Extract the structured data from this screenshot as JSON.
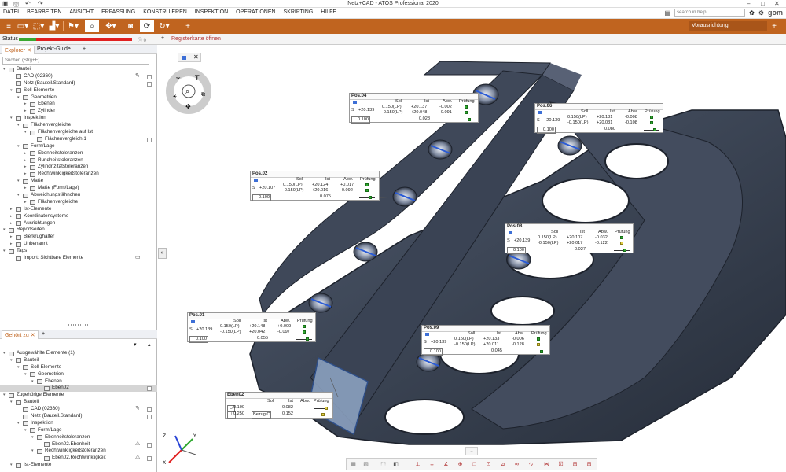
{
  "window": {
    "title": "Netz+CAD - ATOS Professional 2020",
    "search_placeholder": "search in help",
    "logo": "gom"
  },
  "menu": [
    "DATEI",
    "BEARBEITEN",
    "ANSICHT",
    "ERFASSUNG",
    "KONSTRUIEREN",
    "INSPEKTION",
    "OPERATIONEN",
    "SKRIPTING",
    "HILFE"
  ],
  "toolbar": {
    "alignment_label": "Vorausrichtung",
    "accent": "#c0641f"
  },
  "status": {
    "label": "Status",
    "count": "0",
    "progress": 0.15,
    "colors": {
      "ok": "#39a830",
      "error": "#e02020"
    }
  },
  "report": {
    "link": "Registerkarte öffnen"
  },
  "explorer": {
    "tabs": [
      "Explorer",
      "Projekt-Guide"
    ],
    "search_placeholder": "Suchen (Strg+F)",
    "tree": [
      {
        "d": 0,
        "t": "Bauteil",
        "ar": "▾"
      },
      {
        "d": 1,
        "t": "CAD (02360)",
        "r1": "✎",
        "r2": "eye"
      },
      {
        "d": 1,
        "t": "Netz (Bauteil.Standard)",
        "r2": "box"
      },
      {
        "d": 1,
        "t": "Soll-Elemente",
        "ar": "▾"
      },
      {
        "d": 2,
        "t": "Geometrien",
        "ar": "▾"
      },
      {
        "d": 3,
        "t": "Ebenen",
        "ar": "▸"
      },
      {
        "d": 3,
        "t": "Zylinder",
        "ar": "▸"
      },
      {
        "d": 1,
        "t": "Inspektion",
        "ar": "▾"
      },
      {
        "d": 2,
        "t": "Flächenvergleiche",
        "ar": "▾"
      },
      {
        "d": 3,
        "t": "Flächenvergleiche auf Ist",
        "ar": "▾"
      },
      {
        "d": 4,
        "t": "Flächenvergleich 1",
        "r2": "box"
      },
      {
        "d": 2,
        "t": "Form/Lage",
        "ar": "▾"
      },
      {
        "d": 3,
        "t": "Ebenheitstoleranzen",
        "ar": "▸"
      },
      {
        "d": 3,
        "t": "Rundheitstoleranzen",
        "ar": "▸"
      },
      {
        "d": 3,
        "t": "Zylindrizitätstoleranzen",
        "ar": "▸"
      },
      {
        "d": 3,
        "t": "Rechtwinkligkeitstoleranzen",
        "ar": "▸"
      },
      {
        "d": 2,
        "t": "Maße",
        "ar": "▾"
      },
      {
        "d": 3,
        "t": "Maße (Form/Lage)",
        "ar": "▸"
      },
      {
        "d": 2,
        "t": "Abweichungsfähnchen",
        "ar": "▾"
      },
      {
        "d": 3,
        "t": "Flächenvergleiche",
        "ar": "▸"
      },
      {
        "d": 1,
        "t": "Ist-Elemente",
        "ar": "▸"
      },
      {
        "d": 1,
        "t": "Koordinatensysteme",
        "ar": "▸"
      },
      {
        "d": 1,
        "t": "Ausrichtungen",
        "ar": "▸"
      },
      {
        "d": 0,
        "t": "Reportseiten",
        "ar": "▾"
      },
      {
        "d": 1,
        "t": "Bierkrughalter",
        "ar": "▸"
      },
      {
        "d": 1,
        "t": "Unbenannt",
        "ar": "▸"
      },
      {
        "d": 0,
        "t": "Tags",
        "ar": "▾"
      },
      {
        "d": 1,
        "t": "Import: Sichtbare Elemente",
        "r1": "▭"
      }
    ]
  },
  "belongs": {
    "tab": "Gehört zu",
    "tree": [
      {
        "d": 0,
        "t": "Ausgewählte Elemente (1)",
        "ar": "▾"
      },
      {
        "d": 1,
        "t": "Bauteil",
        "ar": "▾"
      },
      {
        "d": 2,
        "t": "Soll-Elemente",
        "ar": "▾"
      },
      {
        "d": 3,
        "t": "Geometrien",
        "ar": "▾"
      },
      {
        "d": 4,
        "t": "Ebenen",
        "ar": "▾"
      },
      {
        "d": 5,
        "t": "Eben02",
        "r2": "eye",
        "sel": true
      },
      {
        "d": 0,
        "t": "Zugehörige Elemente",
        "ar": "▾"
      },
      {
        "d": 1,
        "t": "Bauteil",
        "ar": "▾"
      },
      {
        "d": 2,
        "t": "CAD (02360)",
        "r1": "✎",
        "r2": "eye"
      },
      {
        "d": 2,
        "t": "Netz (Bauteil.Standard)",
        "r2": "box"
      },
      {
        "d": 2,
        "t": "Inspektion",
        "ar": "▾"
      },
      {
        "d": 3,
        "t": "Form/Lage",
        "ar": "▾"
      },
      {
        "d": 4,
        "t": "Ebenheitstoleranzen",
        "ar": "▾"
      },
      {
        "d": 5,
        "t": "Eben02.Ebenheit",
        "r1": "⚠",
        "r2": "eye"
      },
      {
        "d": 4,
        "t": "Rechtwinkligkeitstoleranzen",
        "ar": "▾"
      },
      {
        "d": 5,
        "t": "Eben02.Rechtwinkligkeit",
        "r1": "⚠",
        "r2": "eye"
      },
      {
        "d": 1,
        "t": "Ist-Elemente",
        "ar": "▾"
      }
    ]
  },
  "callouts": [
    {
      "title": "Pos.04",
      "headers": [
        "Soll",
        "Ist",
        "Abw.",
        "Prüfung"
      ],
      "x_nom": "+20.139",
      "soll": [
        "0.150(LP)",
        "-0.150(LP)"
      ],
      "ist": [
        "+20.137",
        "+20.048"
      ],
      "abw": [
        "-0.002",
        "-0.091"
      ],
      "tol_label": "0.100",
      "form": "0.028",
      "dev_colors": [
        "green",
        "green"
      ]
    },
    {
      "title": "Pos.06",
      "headers": [
        "Soll",
        "Ist",
        "Abw.",
        "Prüfung"
      ],
      "x_nom": "+20.139",
      "soll": [
        "0.150(LP)",
        "-0.150(LP)"
      ],
      "ist": [
        "+20.131",
        "+20.031"
      ],
      "abw": [
        "-0.008",
        "-0.108"
      ],
      "tol_label": "0.100",
      "form": "0.080",
      "dev_colors": [
        "green",
        "green"
      ]
    },
    {
      "title": "Pos.02",
      "headers": [
        "Soll",
        "Ist",
        "Abw.",
        "Prüfung"
      ],
      "x_nom": "+20.107",
      "soll": [
        "0.150(LP)",
        "-0.150(LP)"
      ],
      "ist": [
        "+20.124",
        "+20.016"
      ],
      "abw": [
        "+0.017",
        "-0.092"
      ],
      "tol_label": "0.100",
      "form": "0.075",
      "dev_colors": [
        "green",
        "green"
      ]
    },
    {
      "title": "Pos.08",
      "headers": [
        "Soll",
        "Ist",
        "Abw.",
        "Prüfung"
      ],
      "x_nom": "+20.139",
      "soll": [
        "0.150(LP)",
        "-0.150(LP)"
      ],
      "ist": [
        "+20.107",
        "+20.017"
      ],
      "abw": [
        "-0.032",
        "-0.122"
      ],
      "tol_label": "0.100",
      "form": "0.027",
      "dev_colors": [
        "green",
        "yellow"
      ]
    },
    {
      "title": "Pos.01",
      "headers": [
        "Soll",
        "Ist",
        "Abw.",
        "Prüfung"
      ],
      "x_nom": "+20.139",
      "soll": [
        "0.150(LP)",
        "-0.150(LP)"
      ],
      "ist": [
        "+20.148",
        "+20.042"
      ],
      "abw": [
        "+0.009",
        "-0.097"
      ],
      "tol_label": "0.100",
      "form": "0.055",
      "dev_colors": [
        "green",
        "green"
      ]
    },
    {
      "title": "Pos.09",
      "headers": [
        "Soll",
        "Ist",
        "Abw.",
        "Prüfung"
      ],
      "x_nom": "+20.139",
      "soll": [
        "0.150(LP)",
        "-0.150(LP)"
      ],
      "ist": [
        "+20.133",
        "+20.011"
      ],
      "abw": [
        "-0.006",
        "-0.128"
      ],
      "tol_label": "0.100",
      "form": "0.045",
      "dev_colors": [
        "green",
        "yellow"
      ]
    }
  ],
  "eben": {
    "title": "Eben02",
    "headers": [
      "Soll",
      "Ist",
      "Abw.",
      "Prüfung"
    ],
    "rows": [
      {
        "soll": "0.100",
        "ist": "0.082"
      },
      {
        "soll": "0.250",
        "ref": "Bezug C",
        "ist": "0.152"
      }
    ]
  },
  "axis": {
    "x": "X",
    "y": "Y",
    "z": "Z"
  }
}
